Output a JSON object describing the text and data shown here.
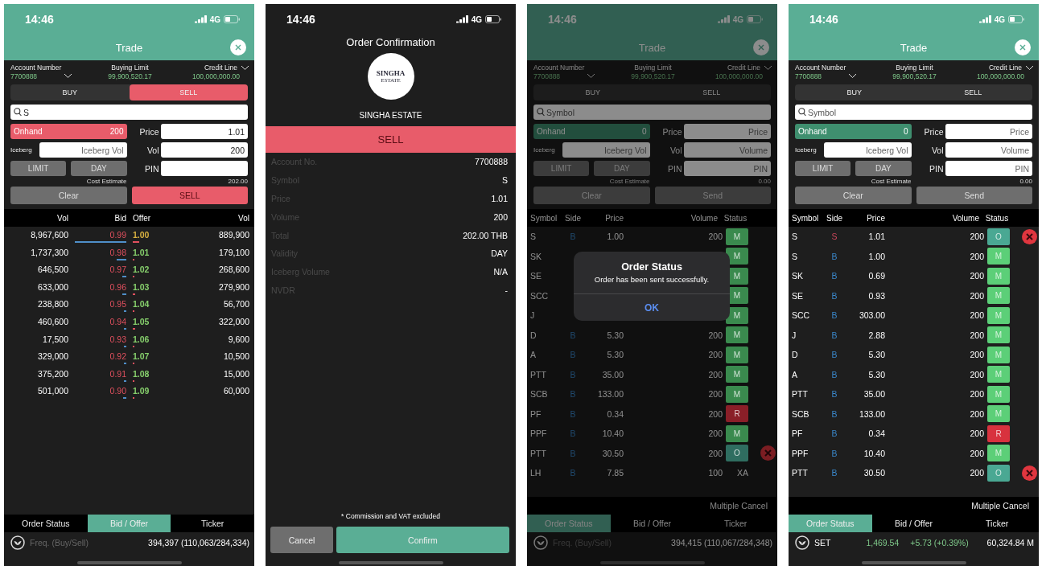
{
  "screens": [
    {
      "kind": "trade",
      "dimmed": false,
      "status_bar": {
        "time": "14:46",
        "network": "4G"
      },
      "title": "Trade",
      "account": {
        "number_label": "Account Number",
        "number": "7700888",
        "limit_label": "Buying Limit",
        "limit": "99,900,520.17",
        "credit_label": "Credit Line",
        "credit": "100,000,000.00"
      },
      "sides": [
        {
          "label": "BUY",
          "selected": false
        },
        {
          "label": "SELL",
          "selected": true
        }
      ],
      "search": {
        "value": "S"
      },
      "onhand": {
        "label": "Onhand",
        "value": "200"
      },
      "fields": {
        "iceberg": {
          "label": "Iceberg",
          "placeholder": "Iceberg Vol"
        },
        "price": {
          "label": "Price",
          "value": "1.01"
        },
        "volume": {
          "label": "Vol",
          "value": "200"
        },
        "pin": {
          "label": "PIN"
        }
      },
      "order_types": [
        "LIMIT",
        "DAY"
      ],
      "cost": {
        "label": "Cost Estimate",
        "value": "202.00"
      },
      "clear": "Clear",
      "submit": "SELL",
      "panel": {
        "kind": "bid_offer",
        "columns": [
          "Vol",
          "Bid",
          "Offer",
          "Vol"
        ],
        "rows": [
          {
            "bid_vol": "8,967,600",
            "bid": "0.99",
            "offer": "1.00",
            "offer_vol": "889,900",
            "color": "#d8b040"
          },
          {
            "bid_vol": "1,737,300",
            "bid": "0.98",
            "offer": "1.01",
            "offer_vol": "179,100",
            "color": "#86cf6c"
          },
          {
            "bid_vol": "646,500",
            "bid": "0.97",
            "offer": "1.02",
            "offer_vol": "268,600",
            "color": "#86cf6c"
          },
          {
            "bid_vol": "633,000",
            "bid": "0.96",
            "offer": "1.03",
            "offer_vol": "279,900",
            "color": "#86cf6c"
          },
          {
            "bid_vol": "238,800",
            "bid": "0.95",
            "offer": "1.04",
            "offer_vol": "56,700",
            "color": "#86cf6c"
          },
          {
            "bid_vol": "460,600",
            "bid": "0.94",
            "offer": "1.05",
            "offer_vol": "322,000",
            "color": "#86cf6c"
          },
          {
            "bid_vol": "17,500",
            "bid": "0.93",
            "offer": "1.06",
            "offer_vol": "9,600",
            "color": "#86cf6c"
          },
          {
            "bid_vol": "329,000",
            "bid": "0.92",
            "offer": "1.07",
            "offer_vol": "10,500",
            "color": "#86cf6c"
          },
          {
            "bid_vol": "375,200",
            "bid": "0.91",
            "offer": "1.08",
            "offer_vol": "15,000",
            "color": "#86cf6c"
          },
          {
            "bid_vol": "501,000",
            "bid": "0.90",
            "offer": "1.09",
            "offer_vol": "60,000",
            "color": "#86cf6c"
          }
        ]
      },
      "tabs": [
        {
          "label": "Order Status",
          "selected": false
        },
        {
          "label": "Bid / Offer",
          "selected": true
        },
        {
          "label": "Ticker",
          "selected": false
        }
      ],
      "footer": {
        "kind": "freq",
        "label": "Freq. (Buy/Sell)",
        "value": "394,397 (110,063/284,334)"
      }
    },
    {
      "kind": "confirm",
      "status_bar": {
        "time": "14:46",
        "network": "4G"
      },
      "title": "Order Confirmation",
      "logo": {
        "line1": "SINGHA",
        "line2": "ESTATE"
      },
      "company": "SINGHA ESTATE",
      "side": {
        "label": "SELL",
        "kind": "sell"
      },
      "details": [
        {
          "label": "Account No.",
          "value": "7700888"
        },
        {
          "label": "Symbol",
          "value": "S"
        },
        {
          "label": "Price",
          "value": "1.01"
        },
        {
          "label": "Volume",
          "value": "200"
        },
        {
          "label": "Total",
          "value": "202.00 THB"
        },
        {
          "label": "Validity",
          "value": "DAY"
        },
        {
          "label": "Iceberg Volume",
          "value": "N/A"
        },
        {
          "label": "NVDR",
          "value": "-"
        }
      ],
      "note": "* Commission and VAT excluded",
      "cancel": "Cancel",
      "confirm": "Confirm"
    },
    {
      "kind": "trade",
      "dimmed": true,
      "status_bar": {
        "time": "14:46",
        "network": "4G"
      },
      "title": "Trade",
      "account": {
        "number_label": "Account Number",
        "number": "7700888",
        "limit_label": "Buying Limit",
        "limit": "99,900,520.17",
        "credit_label": "Credit Line",
        "credit": "100,000,000.00"
      },
      "sides": [
        {
          "label": "BUY",
          "selected": false
        },
        {
          "label": "SELL",
          "selected": false
        }
      ],
      "search": {
        "placeholder": "Symbol"
      },
      "onhand": {
        "label": "Onhand",
        "value": "0"
      },
      "fields": {
        "iceberg": {
          "label": "Iceberg",
          "placeholder": "Iceberg Vol"
        },
        "price": {
          "label": "Price",
          "placeholder": "Price"
        },
        "volume": {
          "label": "Vol",
          "placeholder": "Volume"
        },
        "pin": {
          "label": "PIN",
          "placeholder": "PIN"
        }
      },
      "order_types": [
        "LIMIT",
        "DAY"
      ],
      "cost": {
        "label": "Cost Estimate",
        "value": "0.00"
      },
      "clear": "Clear",
      "submit": "Send",
      "panel": {
        "kind": "orders",
        "columns": [
          "Symbol",
          "Side",
          "Price",
          "Volume",
          "Status"
        ],
        "multiple_cancel": "Multiple Cancel",
        "rows": [
          {
            "symbol": "S",
            "side": "B",
            "kind": "buy",
            "price": "1.00",
            "volume": "200",
            "status": "M",
            "color": "#3a8a4e",
            "cancellable": false
          },
          {
            "symbol": "SK",
            "status": "M",
            "color": "#3a8a4e",
            "cancellable": false
          },
          {
            "symbol": "SE",
            "status": "M",
            "color": "#3a8a4e",
            "cancellable": false
          },
          {
            "symbol": "SCC",
            "status": "M",
            "color": "#3a8a4e",
            "cancellable": false
          },
          {
            "symbol": "J",
            "status": "M",
            "color": "#3a8a4e",
            "cancellable": false
          },
          {
            "symbol": "D",
            "side": "B",
            "kind": "buy",
            "price": "5.30",
            "volume": "200",
            "status": "M",
            "color": "#3a8a4e",
            "cancellable": false
          },
          {
            "symbol": "A",
            "side": "B",
            "kind": "buy",
            "price": "5.30",
            "volume": "200",
            "status": "M",
            "color": "#3a8a4e",
            "cancellable": false
          },
          {
            "symbol": "PTT",
            "side": "B",
            "kind": "buy",
            "price": "35.00",
            "volume": "200",
            "status": "M",
            "color": "#3a8a4e",
            "cancellable": false
          },
          {
            "symbol": "SCB",
            "side": "B",
            "kind": "buy",
            "price": "133.00",
            "volume": "200",
            "status": "M",
            "color": "#3a8a4e",
            "cancellable": false
          },
          {
            "symbol": "PF",
            "side": "B",
            "kind": "buy",
            "price": "0.34",
            "volume": "200",
            "status": "R",
            "color": "#8a1f28",
            "cancellable": false
          },
          {
            "symbol": "PPF",
            "side": "B",
            "kind": "buy",
            "price": "10.40",
            "volume": "200",
            "status": "M",
            "color": "#3a8a4e",
            "cancellable": false
          },
          {
            "symbol": "PTT",
            "side": "B",
            "kind": "buy",
            "price": "30.50",
            "volume": "200",
            "status": "O",
            "color": "#2f6d60",
            "cancellable": true
          },
          {
            "symbol": "LH",
            "side": "B",
            "kind": "buy",
            "price": "7.85",
            "volume": "100",
            "status": "XA",
            "cancellable": false
          }
        ]
      },
      "dialog": {
        "title": "Order Status",
        "message": "Order has been sent successfully.",
        "button": "OK"
      },
      "tabs": [
        {
          "label": "Order Status",
          "selected": true
        },
        {
          "label": "Bid / Offer",
          "selected": false
        },
        {
          "label": "Ticker",
          "selected": false
        }
      ],
      "footer": {
        "kind": "freq",
        "label": "Freq. (Buy/Sell)",
        "value": "394,415 (110,067/284,348)"
      }
    },
    {
      "kind": "trade",
      "dimmed": false,
      "status_bar": {
        "time": "14:46",
        "network": "4G"
      },
      "title": "Trade",
      "account": {
        "number_label": "Account Number",
        "number": "7700888",
        "limit_label": "Buying Limit",
        "limit": "99,900,520.17",
        "credit_label": "Credit Line",
        "credit": "100,000,000.00"
      },
      "sides": [
        {
          "label": "BUY",
          "selected": false
        },
        {
          "label": "SELL",
          "selected": false
        }
      ],
      "search": {
        "placeholder": "Symbol"
      },
      "onhand": {
        "label": "Onhand",
        "value": "0"
      },
      "fields": {
        "iceberg": {
          "label": "Iceberg",
          "placeholder": "Iceberg Vol"
        },
        "price": {
          "label": "Price",
          "placeholder": "Price"
        },
        "volume": {
          "label": "Vol",
          "placeholder": "Volume"
        },
        "pin": {
          "label": "PIN",
          "placeholder": "PIN"
        }
      },
      "order_types": [
        "LIMIT",
        "DAY"
      ],
      "cost": {
        "label": "Cost Estimate",
        "value": "0.00"
      },
      "clear": "Clear",
      "submit": "Send",
      "panel": {
        "kind": "orders",
        "columns": [
          "Symbol",
          "Side",
          "Price",
          "Volume",
          "Status"
        ],
        "multiple_cancel": "Multiple Cancel",
        "rows": [
          {
            "symbol": "S",
            "side": "S",
            "kind": "sell",
            "price": "1.01",
            "volume": "200",
            "status": "O",
            "color": "#4aa893",
            "cancellable": true
          },
          {
            "symbol": "S",
            "side": "B",
            "kind": "buy",
            "price": "1.00",
            "volume": "200",
            "status": "M",
            "color": "#5ccf78",
            "cancellable": false
          },
          {
            "symbol": "SK",
            "side": "B",
            "kind": "buy",
            "price": "0.69",
            "volume": "200",
            "status": "M",
            "color": "#5ccf78",
            "cancellable": false
          },
          {
            "symbol": "SE",
            "side": "B",
            "kind": "buy",
            "price": "0.93",
            "volume": "200",
            "status": "M",
            "color": "#5ccf78",
            "cancellable": false
          },
          {
            "symbol": "SCC",
            "side": "B",
            "kind": "buy",
            "price": "303.00",
            "volume": "200",
            "status": "M",
            "color": "#5ccf78",
            "cancellable": false
          },
          {
            "symbol": "J",
            "side": "B",
            "kind": "buy",
            "price": "2.88",
            "volume": "200",
            "status": "M",
            "color": "#5ccf78",
            "cancellable": false
          },
          {
            "symbol": "D",
            "side": "B",
            "kind": "buy",
            "price": "5.30",
            "volume": "200",
            "status": "M",
            "color": "#5ccf78",
            "cancellable": false
          },
          {
            "symbol": "A",
            "side": "B",
            "kind": "buy",
            "price": "5.30",
            "volume": "200",
            "status": "M",
            "color": "#5ccf78",
            "cancellable": false
          },
          {
            "symbol": "PTT",
            "side": "B",
            "kind": "buy",
            "price": "35.00",
            "volume": "200",
            "status": "M",
            "color": "#5ccf78",
            "cancellable": false
          },
          {
            "symbol": "SCB",
            "side": "B",
            "kind": "buy",
            "price": "133.00",
            "volume": "200",
            "status": "M",
            "color": "#5ccf78",
            "cancellable": false
          },
          {
            "symbol": "PF",
            "side": "B",
            "kind": "buy",
            "price": "0.34",
            "volume": "200",
            "status": "R",
            "color": "#d8323e",
            "cancellable": false
          },
          {
            "symbol": "PPF",
            "side": "B",
            "kind": "buy",
            "price": "10.40",
            "volume": "200",
            "status": "M",
            "color": "#5ccf78",
            "cancellable": false
          },
          {
            "symbol": "PTT",
            "side": "B",
            "kind": "buy",
            "price": "30.50",
            "volume": "200",
            "status": "O",
            "color": "#4aa893",
            "cancellable": true
          }
        ]
      },
      "tabs": [
        {
          "label": "Order Status",
          "selected": true
        },
        {
          "label": "Bid / Offer",
          "selected": false
        },
        {
          "label": "Ticker",
          "selected": false
        }
      ],
      "footer": {
        "kind": "index",
        "label": "SET",
        "value": "1,469.54",
        "change": "+5.73 (+0.39%)",
        "volume": "60,324.84 M"
      }
    }
  ]
}
